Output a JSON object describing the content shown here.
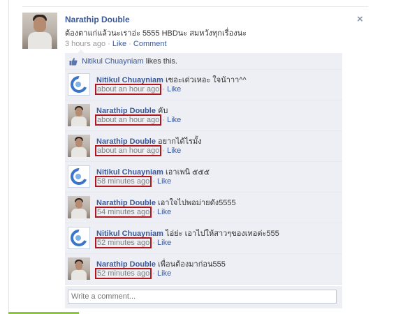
{
  "post": {
    "author": "Narathip Double",
    "text": "ต้องตาแก่แล้วนะเราอ่ะ 5555 HBDนะ สมหวังทุกเรื่องนะ",
    "time": "3 hours ago",
    "separator": "·",
    "like_label": "Like",
    "comment_label": "Comment",
    "close_icon": "×"
  },
  "likes": {
    "name": "Nitikul Chuayniam",
    "suffix": " likes this."
  },
  "comments": [
    {
      "author": "Nitikul Chuayniam",
      "text": "เซอะเด่วเหอะ ใจน้าาา^^",
      "time": "about an hour ago",
      "like_label": "Like"
    },
    {
      "author": "Narathip Double",
      "text": "คับ",
      "time": "about an hour ago",
      "like_label": "Like"
    },
    {
      "author": "Narathip Double",
      "text": "อยากได้ไรมั้ง",
      "time": "about an hour ago",
      "like_label": "Like"
    },
    {
      "author": "Nitikul Chuayniam",
      "text": "เอาเพนิ ๕๕๕",
      "time": "58 minutes ago",
      "like_label": "Like"
    },
    {
      "author": "Narathip Double",
      "text": "เอาใจไปพอม่ายดัง5555",
      "time": "54 minutes ago",
      "like_label": "Like"
    },
    {
      "author": "Nitikul Chuayniam",
      "text": "ไอ่ย่ะ เอาไปให้สาวๆของเทอต่ะ555",
      "time": "52 minutes ago",
      "like_label": "Like"
    },
    {
      "author": "Narathip Double",
      "text": "เพื่อนต้องมาก่อน555",
      "time": "52 minutes ago",
      "like_label": "Like"
    }
  ],
  "comment_box": {
    "placeholder": "Write a comment..."
  },
  "colors": {
    "link": "#3b5998",
    "ufi_bg": "#edeff4",
    "highlight": "#b0161c",
    "accent_bar": "#8cc63f"
  }
}
